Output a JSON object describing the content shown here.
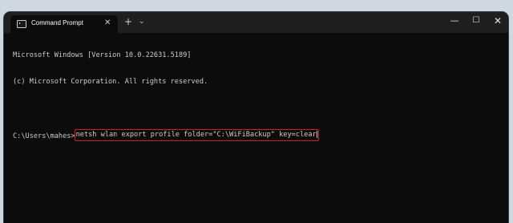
{
  "window": {
    "tab_title": "Command Prompt",
    "tab_close": "✕",
    "new_tab": "+",
    "dropdown": "⌄",
    "minimize": "—",
    "maximize": "☐",
    "close": "✕"
  },
  "console": {
    "lines": [
      "Microsoft Windows [Version 10.0.22631.5189]",
      "(c) Microsoft Corporation. All rights reserved."
    ],
    "prompt": "C:\\Users\\mahes>",
    "command": "netsh wlan export profile folder=\"C:\\WiFiBackup\" key=clear"
  },
  "colors": {
    "highlight": "#e0141e",
    "console_bg": "#0c0c0c",
    "titlebar_bg": "#1f1f1f",
    "text": "#cccccc"
  }
}
